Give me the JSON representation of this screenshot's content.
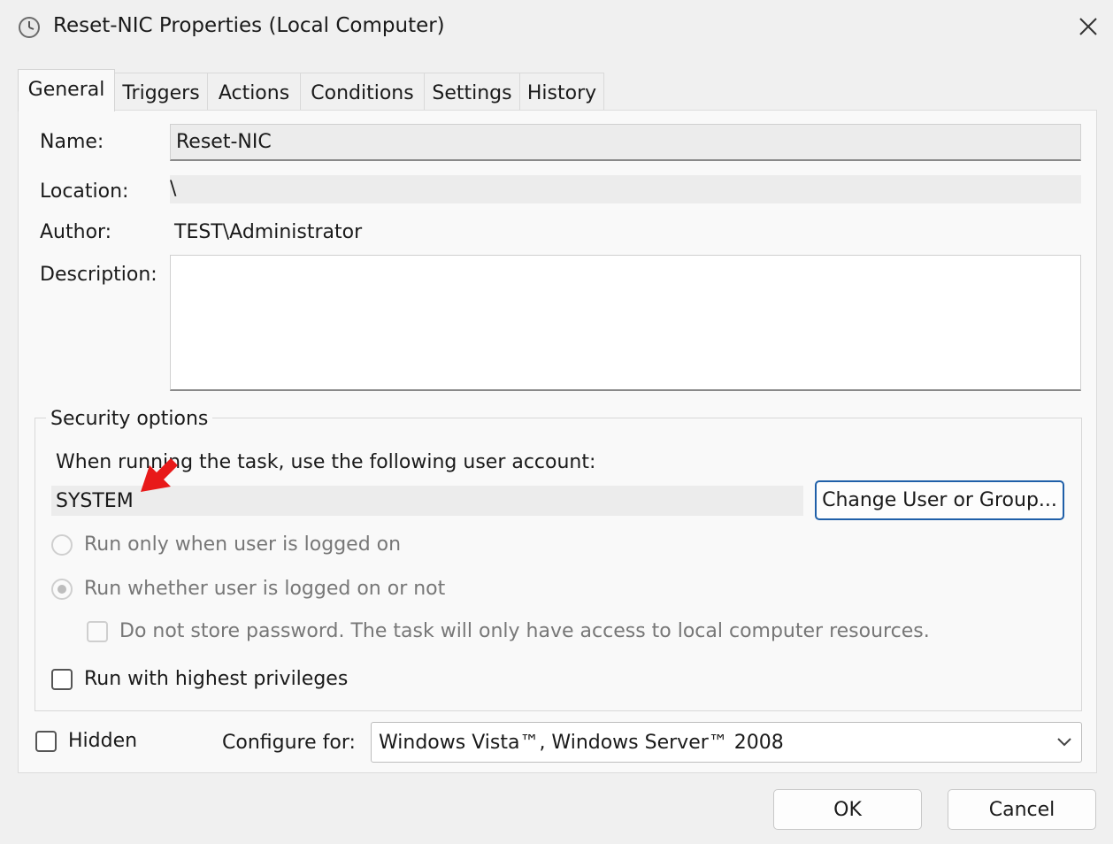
{
  "window": {
    "title": "Reset-NIC Properties (Local Computer)",
    "icon": "clock-icon",
    "close_icon": "close-icon"
  },
  "tabs": [
    {
      "label": "General",
      "active": true
    },
    {
      "label": "Triggers",
      "active": false
    },
    {
      "label": "Actions",
      "active": false
    },
    {
      "label": "Conditions",
      "active": false
    },
    {
      "label": "Settings",
      "active": false
    },
    {
      "label": "History",
      "active": false
    }
  ],
  "general": {
    "name_label": "Name:",
    "name_value": "Reset-NIC",
    "location_label": "Location:",
    "location_value": "\\",
    "author_label": "Author:",
    "author_value": "TEST\\Administrator",
    "description_label": "Description:",
    "description_value": ""
  },
  "security": {
    "legend": "Security options",
    "account_prompt": "When running the task, use the following user account:",
    "account_value": "SYSTEM",
    "change_button": "Change User or Group...",
    "radio_logged_on": "Run only when user is logged on",
    "radio_whether": "Run whether user is logged on or not",
    "do_not_store": "Do not store password.  The task will only have access to local computer resources.",
    "highest_privileges": "Run with highest privileges",
    "annotation_arrow_color": "#e81919"
  },
  "footer": {
    "hidden_label": "Hidden",
    "configure_label": "Configure for:",
    "configure_value": "Windows Vista™, Windows Server™ 2008",
    "ok": "OK",
    "cancel": "Cancel"
  }
}
